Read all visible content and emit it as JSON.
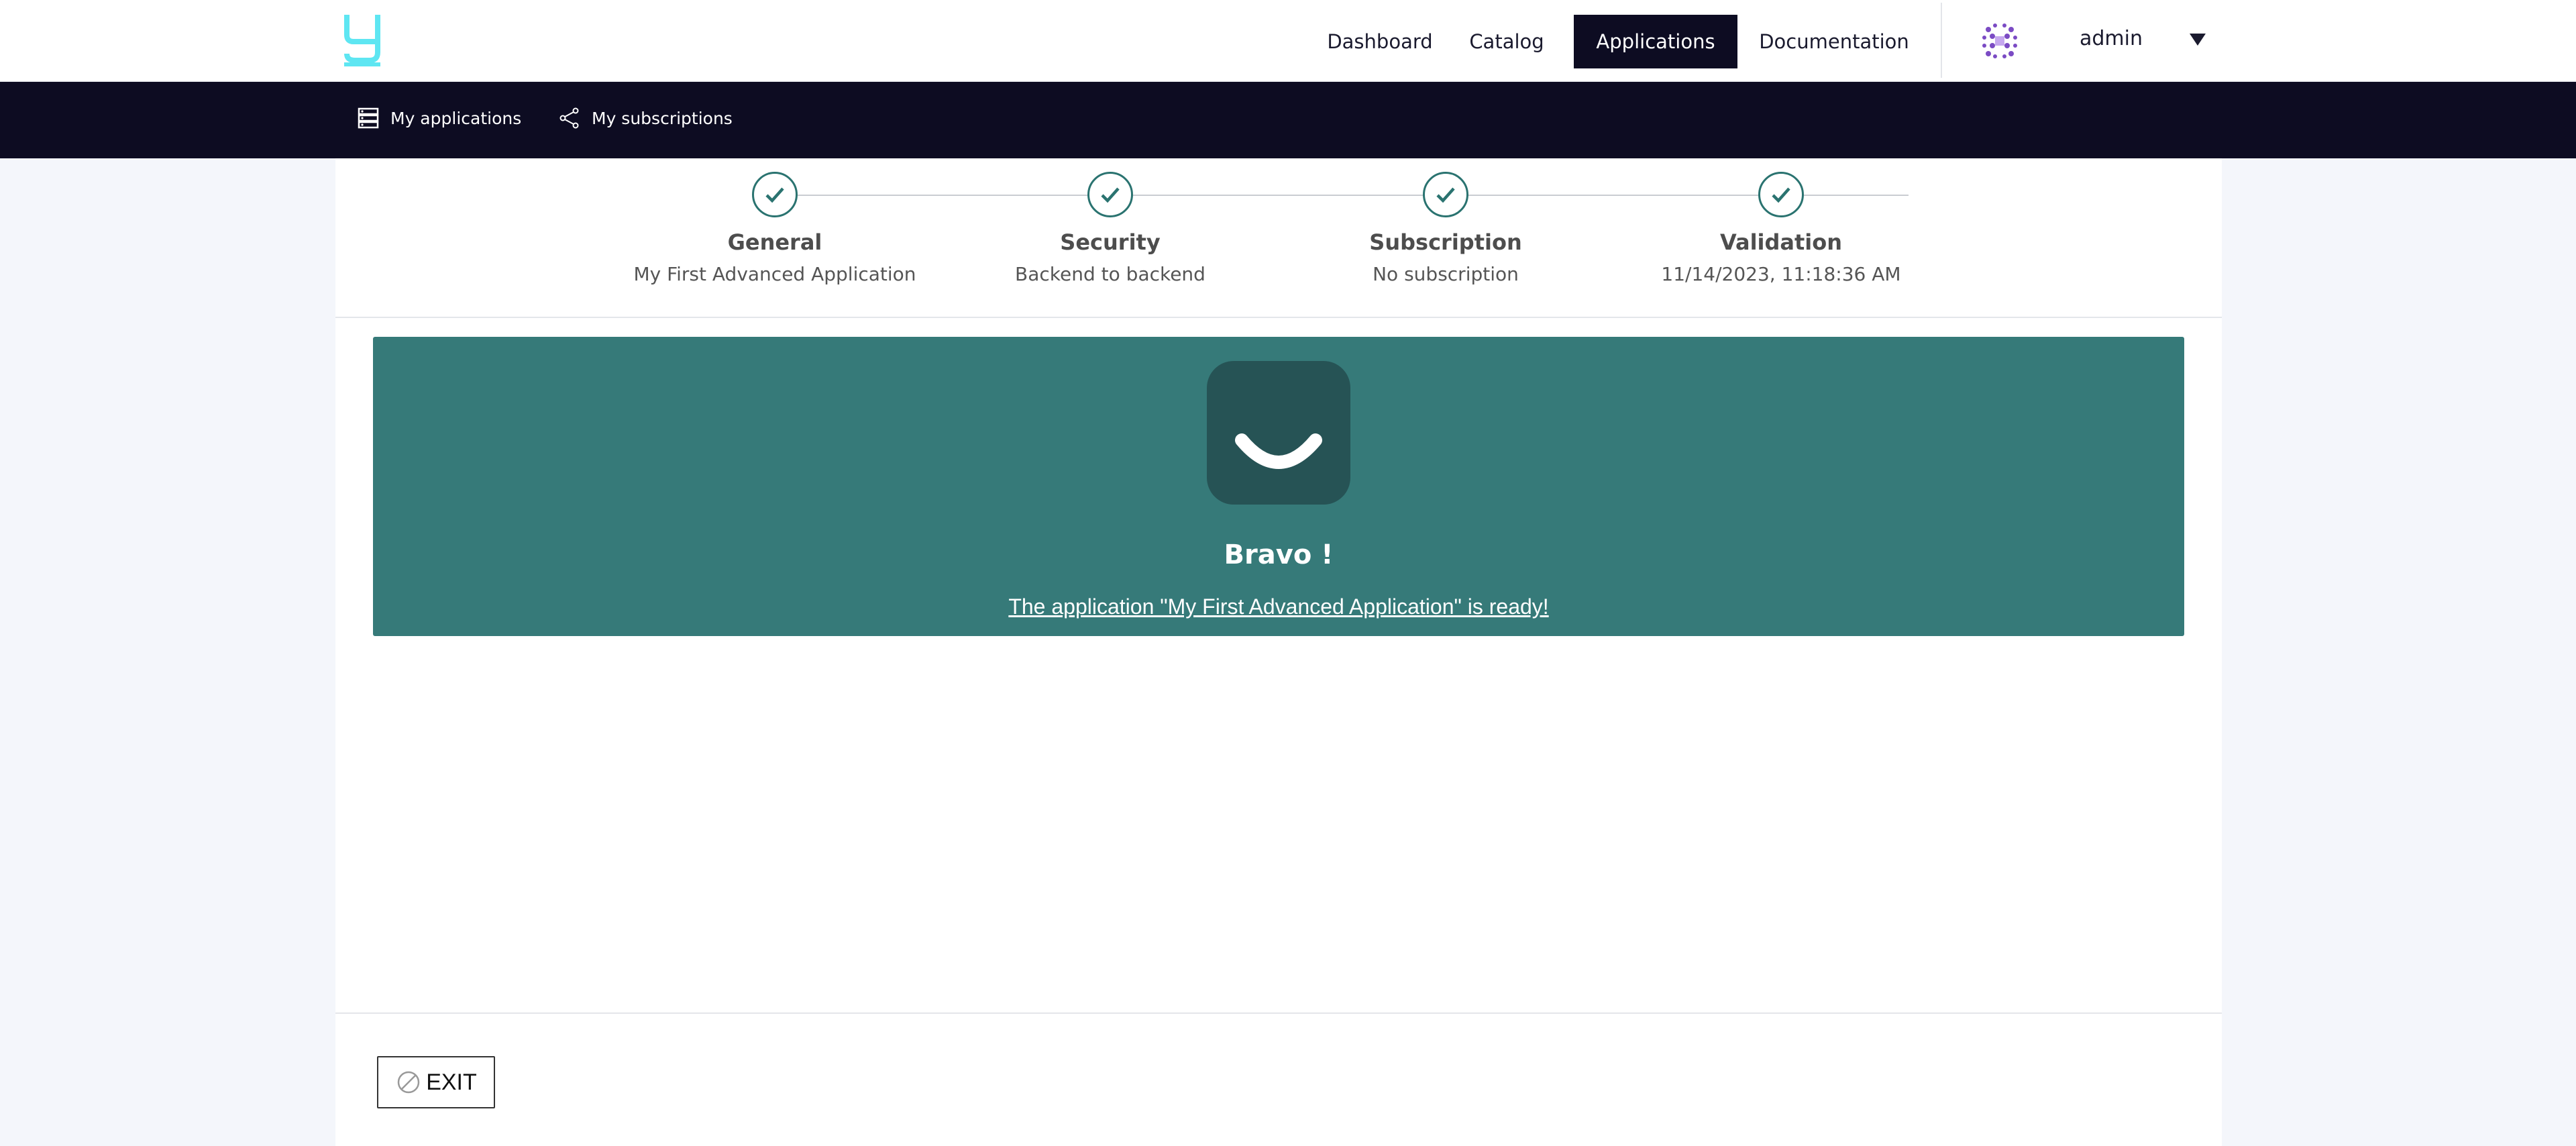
{
  "header": {
    "nav": [
      {
        "label": "Dashboard",
        "active": false
      },
      {
        "label": "Catalog",
        "active": false
      },
      {
        "label": "Applications",
        "active": true
      },
      {
        "label": "Documentation",
        "active": false
      }
    ],
    "user": {
      "name": "admin"
    },
    "logo_icon": "gravitee-logo-icon",
    "colors": {
      "nav_active_bg": "#0d0c22",
      "logo": "#5ee6f2"
    }
  },
  "subnav": {
    "items": [
      {
        "label": "My applications",
        "icon": "server-icon"
      },
      {
        "label": "My subscriptions",
        "icon": "share-icon"
      }
    ]
  },
  "stepper": {
    "steps": [
      {
        "title": "General",
        "subtitle": "My First Advanced Application",
        "done": true
      },
      {
        "title": "Security",
        "subtitle": "Backend to backend",
        "done": true
      },
      {
        "title": "Subscription",
        "subtitle": "No subscription",
        "done": true
      },
      {
        "title": "Validation",
        "subtitle": "11/14/2023, 11:18:36 AM",
        "done": true
      }
    ],
    "colors": {
      "check": "#2a7370"
    }
  },
  "banner": {
    "icon": "smile-icon",
    "title": "Bravo !",
    "message": "The application \"My First Advanced Application\" is ready!",
    "colors": {
      "bg": "#367a79",
      "icon_bg": "#265355"
    }
  },
  "footer": {
    "exit_label": "EXIT",
    "exit_icon": "cancel-circle-icon"
  }
}
